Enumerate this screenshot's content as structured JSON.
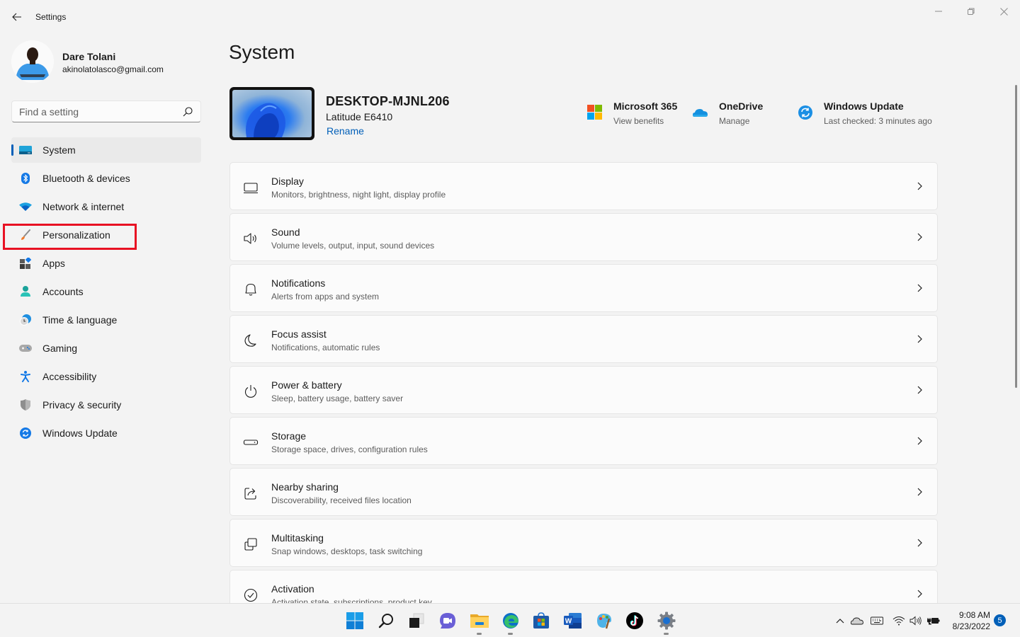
{
  "window": {
    "title": "Settings",
    "back_label": "Back",
    "controls": [
      "minimize",
      "maximize",
      "close"
    ]
  },
  "profile": {
    "name": "Dare Tolani",
    "email": "akinolatolasco@gmail.com"
  },
  "search": {
    "placeholder": "Find a setting",
    "value": ""
  },
  "sidebar": {
    "active": "System",
    "highlighted": "Personalization",
    "items": [
      {
        "label": "System",
        "icon": "monitor-icon"
      },
      {
        "label": "Bluetooth & devices",
        "icon": "bluetooth-icon"
      },
      {
        "label": "Network & internet",
        "icon": "wifi-icon"
      },
      {
        "label": "Personalization",
        "icon": "paintbrush-icon"
      },
      {
        "label": "Apps",
        "icon": "apps-icon"
      },
      {
        "label": "Accounts",
        "icon": "person-icon"
      },
      {
        "label": "Time & language",
        "icon": "globe-clock-icon"
      },
      {
        "label": "Gaming",
        "icon": "gamepad-icon"
      },
      {
        "label": "Accessibility",
        "icon": "accessibility-icon"
      },
      {
        "label": "Privacy & security",
        "icon": "shield-icon"
      },
      {
        "label": "Windows Update",
        "icon": "sync-icon"
      }
    ]
  },
  "main": {
    "title": "System",
    "device": {
      "name": "DESKTOP-MJNL206",
      "model": "Latitude E6410",
      "rename_label": "Rename"
    },
    "quick_links": [
      {
        "title": "Microsoft 365",
        "subtitle": "View benefits",
        "icon": "microsoft-logo-icon"
      },
      {
        "title": "OneDrive",
        "subtitle": "Manage",
        "icon": "onedrive-cloud-icon"
      },
      {
        "title": "Windows Update",
        "subtitle": "Last checked: 3 minutes ago",
        "icon": "windows-update-icon"
      }
    ],
    "cards": [
      {
        "title": "Display",
        "subtitle": "Monitors, brightness, night light, display profile",
        "icon": "laptop-icon"
      },
      {
        "title": "Sound",
        "subtitle": "Volume levels, output, input, sound devices",
        "icon": "speaker-icon"
      },
      {
        "title": "Notifications",
        "subtitle": "Alerts from apps and system",
        "icon": "bell-icon"
      },
      {
        "title": "Focus assist",
        "subtitle": "Notifications, automatic rules",
        "icon": "moon-icon"
      },
      {
        "title": "Power & battery",
        "subtitle": "Sleep, battery usage, battery saver",
        "icon": "power-icon"
      },
      {
        "title": "Storage",
        "subtitle": "Storage space, drives, configuration rules",
        "icon": "storage-icon"
      },
      {
        "title": "Nearby sharing",
        "subtitle": "Discoverability, received files location",
        "icon": "share-icon"
      },
      {
        "title": "Multitasking",
        "subtitle": "Snap windows, desktops, task switching",
        "icon": "multitask-icon"
      },
      {
        "title": "Activation",
        "subtitle": "Activation state, subscriptions, product key",
        "icon": "check-circle-icon"
      }
    ]
  },
  "taskbar": {
    "apps": [
      {
        "name": "Start",
        "icon": "windows-start-icon",
        "running": false
      },
      {
        "name": "Search",
        "icon": "search-icon",
        "running": false
      },
      {
        "name": "Task View",
        "icon": "task-view-icon",
        "running": false
      },
      {
        "name": "Chat",
        "icon": "chat-icon",
        "running": false
      },
      {
        "name": "File Explorer",
        "icon": "folder-icon",
        "running": true
      },
      {
        "name": "Microsoft Edge",
        "icon": "edge-icon",
        "running": true
      },
      {
        "name": "Microsoft Store",
        "icon": "store-icon",
        "running": false
      },
      {
        "name": "Word",
        "icon": "word-icon",
        "running": false
      },
      {
        "name": "Paint",
        "icon": "paint-icon",
        "running": false
      },
      {
        "name": "TikTok",
        "icon": "tiktok-icon",
        "running": false
      },
      {
        "name": "Settings",
        "icon": "settings-gear-icon",
        "running": true
      }
    ],
    "tray": {
      "time": "9:08 AM",
      "date": "8/23/2022",
      "notification_count": "5",
      "icons": [
        "chevron-up-icon",
        "onedrive-tray-icon",
        "keyboard-icon",
        "wifi-tray-icon",
        "volume-icon",
        "battery-charging-icon"
      ]
    }
  },
  "colors": {
    "accent": "#005fb8",
    "highlight_box": "#e81123",
    "background": "#f3f3f3",
    "card": "#fbfbfb"
  }
}
